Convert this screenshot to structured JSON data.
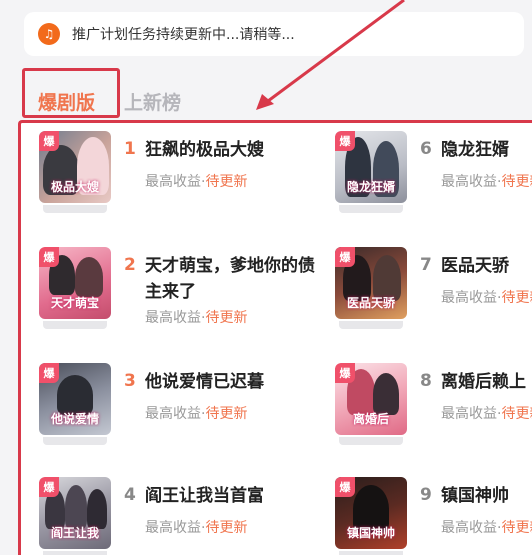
{
  "notice": {
    "icon": "speaker-icon",
    "text": "推广计划任务持续更新中...请稍等..."
  },
  "tabs": [
    {
      "label": "爆剧版",
      "active": true
    },
    {
      "label": "上新榜",
      "active": false
    }
  ],
  "colors": {
    "accent": "#f0754e",
    "highlight": "#d8394a",
    "badge": "#f0506a"
  },
  "badge_label": "爆",
  "earn_label": "最高收益·",
  "items": [
    {
      "rank": "1",
      "title": "狂飙的极品大嫂",
      "status": "待更新"
    },
    {
      "rank": "2",
      "title": "天才萌宝，爹地你的债主来了",
      "status": "待更新"
    },
    {
      "rank": "3",
      "title": "他说爱情已迟暮",
      "status": "待更新"
    },
    {
      "rank": "4",
      "title": "阎王让我当首富",
      "status": "待更新"
    },
    {
      "rank": "6",
      "title": "隐龙狂婿",
      "status": "待更新"
    },
    {
      "rank": "7",
      "title": "医品天骄",
      "status": "待更新"
    },
    {
      "rank": "8",
      "title": "离婚后赖上",
      "status": "待更新"
    },
    {
      "rank": "9",
      "title": "镇国神帅",
      "status": "待更新"
    }
  ]
}
